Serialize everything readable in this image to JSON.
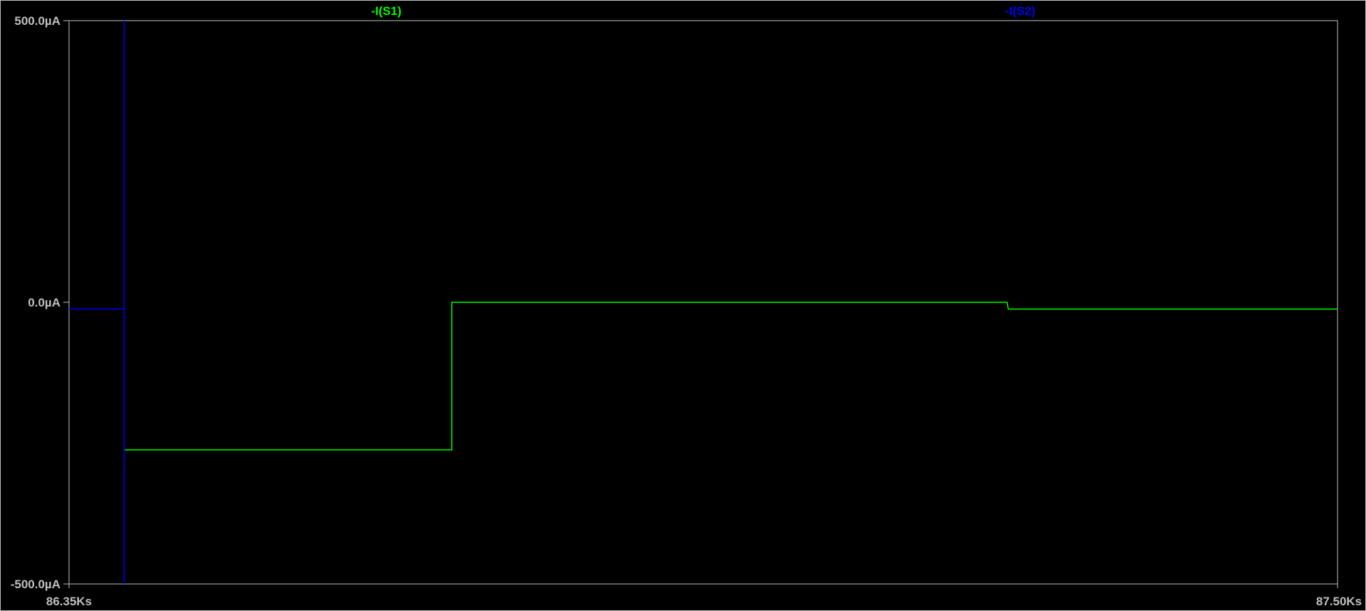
{
  "chart_data": {
    "type": "line",
    "title": "",
    "xlabel": "",
    "ylabel": "",
    "xlim": [
      86.35,
      87.5
    ],
    "ylim": [
      -500,
      500
    ],
    "x_unit": "Ks",
    "y_unit": "µA",
    "grid": false,
    "background": "#000000",
    "axis_color": "#bfbfbf",
    "y_ticks": [
      {
        "value": 500,
        "label": "500.0µA"
      },
      {
        "value": 0,
        "label": "0.0µA"
      },
      {
        "value": -500,
        "label": "-500.0µA"
      }
    ],
    "x_ticks": [
      {
        "value": 86.35,
        "label": "86.35Ks"
      },
      {
        "value": 87.5,
        "label": "87.50Ks"
      }
    ],
    "series": [
      {
        "name": "-I(S1)",
        "color": "#00ff00",
        "points": [
          [
            86.4005,
            -262
          ],
          [
            86.697,
            -262
          ],
          [
            86.697,
            0
          ],
          [
            87.2005,
            0
          ],
          [
            87.2015,
            -12
          ],
          [
            87.5,
            -12
          ]
        ]
      },
      {
        "name": "-I(S2)",
        "color": "#0000ff",
        "points": [
          [
            86.35,
            -12
          ],
          [
            86.4,
            -12
          ],
          [
            86.4,
            500
          ],
          [
            86.4,
            -500
          ]
        ]
      }
    ]
  }
}
